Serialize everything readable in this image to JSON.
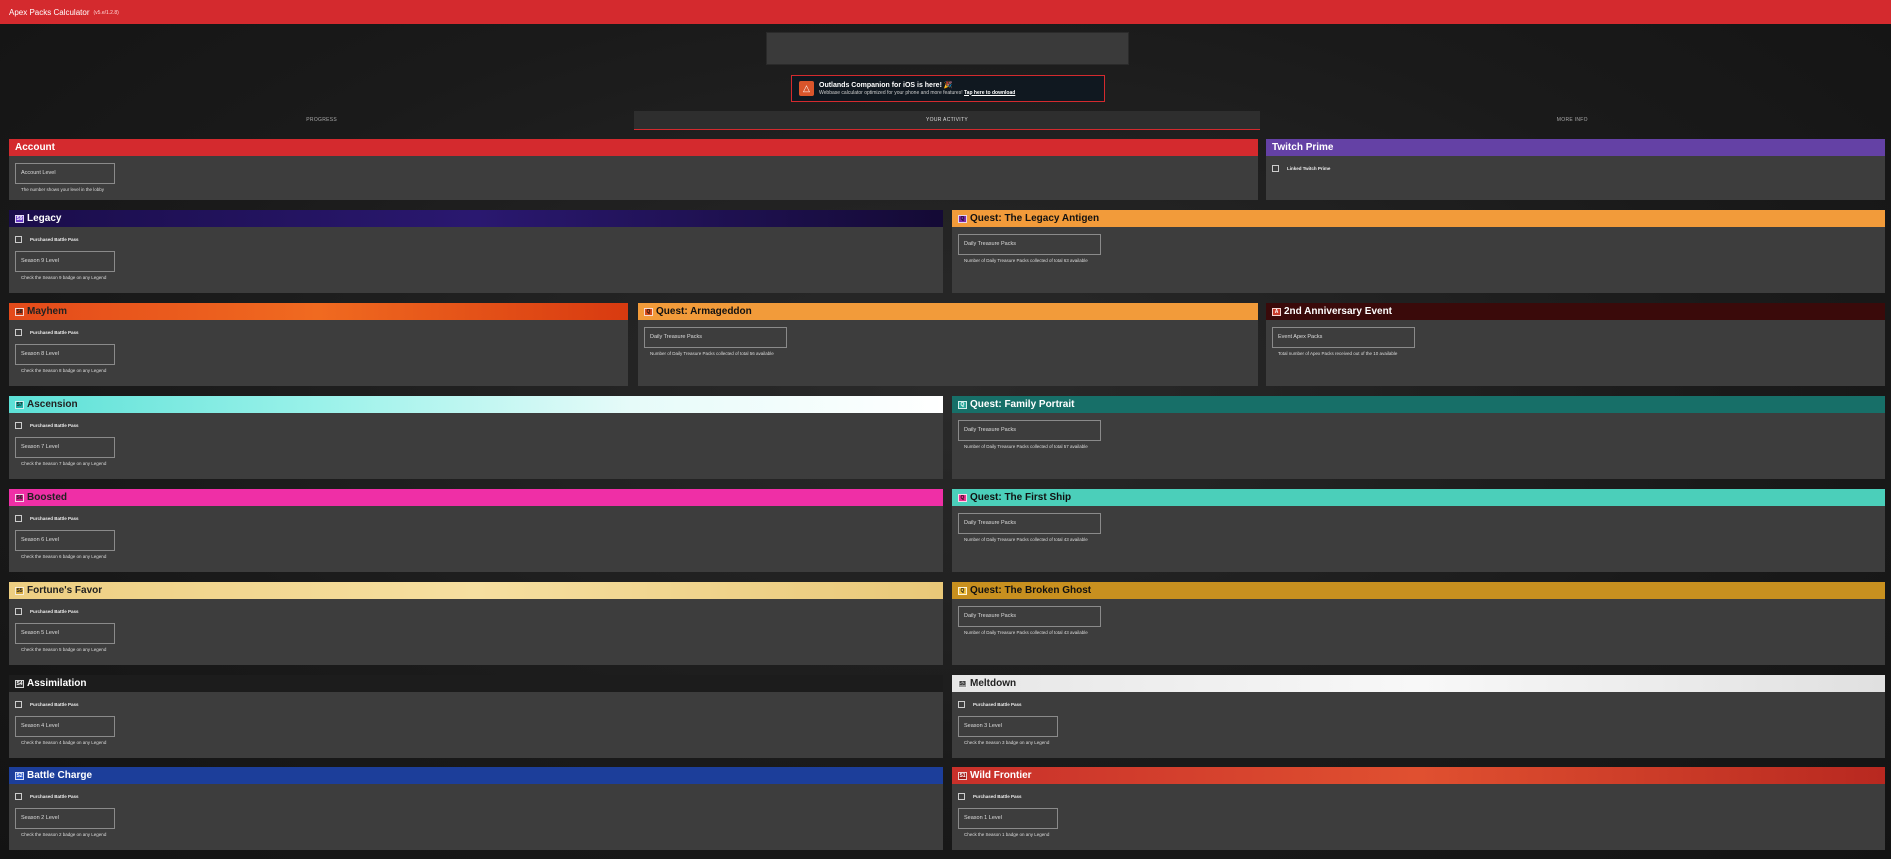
{
  "app": {
    "title": "Apex Packs Calculator",
    "version": "(v5.e/1.2.8)"
  },
  "promo": {
    "logo_icon": "apex-logo-icon",
    "headline": "Outlands Companion for iOS is here! 🎉",
    "sub": "Webbase calculator optimized for your phone and more features!",
    "link": "Tap here to download"
  },
  "tabs": [
    {
      "label": "PROGRESS"
    },
    {
      "label": "YOUR ACTIVITY"
    },
    {
      "label": "MORE INFO"
    }
  ],
  "account": {
    "title": "Account",
    "field": "Account Level",
    "hint": "The number shows your level in the lobby"
  },
  "twitch": {
    "title": "Twitch Prime",
    "checkbox": "Linked Twitch Prime"
  },
  "seasons": {
    "legacy": {
      "title": "Legacy",
      "checkbox": "Purchased Battle Pass",
      "field": "Season 9 Level",
      "hint": "Check the Season 9 badge on any Legend"
    },
    "mayhem": {
      "title": "Mayhem",
      "checkbox": "Purchased Battle Pass",
      "field": "Season 8 Level",
      "hint": "Check the Season 8 badge on any Legend"
    },
    "ascension": {
      "title": "Ascension",
      "checkbox": "Purchased Battle Pass",
      "field": "Season 7 Level",
      "hint": "Check the Season 7 badge on any Legend"
    },
    "boosted": {
      "title": "Boosted",
      "checkbox": "Purchased Battle Pass",
      "field": "Season 6 Level",
      "hint": "Check the Season 6 badge on any Legend"
    },
    "fortune": {
      "title": "Fortune's Favor",
      "checkbox": "Purchased Battle Pass",
      "field": "Season 5 Level",
      "hint": "Check the Season 5 badge on any Legend"
    },
    "assimilation": {
      "title": "Assimilation",
      "checkbox": "Purchased Battle Pass",
      "field": "Season 4 Level",
      "hint": "Check the Season 4 badge on any Legend"
    },
    "meltdown": {
      "title": "Meltdown",
      "checkbox": "Purchased Battle Pass",
      "field": "Season 3 Level",
      "hint": "Check the Season 3 badge on any Legend"
    },
    "battlecharge": {
      "title": "Battle Charge",
      "checkbox": "Purchased Battle Pass",
      "field": "Season 2 Level",
      "hint": "Check the Season 2 badge on any Legend"
    },
    "wildfrontier": {
      "title": "Wild Frontier",
      "checkbox": "Purchased Battle Pass",
      "field": "Season 1 Level",
      "hint": "Check the Season 1 badge on any Legend"
    }
  },
  "quests": {
    "antigen": {
      "title": "Quest: The Legacy Antigen",
      "field": "Daily Treasure Packs",
      "hint": "Number of Daily Treasure Packs collected of total 63 available"
    },
    "armageddon": {
      "title": "Quest: Armageddon",
      "field": "Daily Treasure Packs",
      "hint": "Number of Daily Treasure Packs collected of total 56 available"
    },
    "family": {
      "title": "Quest: Family Portrait",
      "field": "Daily Treasure Packs",
      "hint": "Number of Daily Treasure Packs collected of total 57 available"
    },
    "firstship": {
      "title": "Quest: The First Ship",
      "field": "Daily Treasure Packs",
      "hint": "Number of Daily Treasure Packs collected of total 43 available"
    },
    "brokenghost": {
      "title": "Quest: The Broken Ghost",
      "field": "Daily Treasure Packs",
      "hint": "Number of Daily Treasure Packs collected of total 43 available"
    }
  },
  "anniversary": {
    "title": "2nd Anniversary Event",
    "field": "Event Apex Packs",
    "hint": "Total number of Apex Packs received out of the 10 available"
  },
  "colors": {
    "brand": "#d42a2e",
    "twitch": "#6441a5",
    "quest_orange": "#f29b3a",
    "anniversary": "#3a0a0a",
    "family": "#176f68",
    "firstship": "#4bcfba",
    "brokenghost": "#c8901f",
    "boosted": "#ef2fa6",
    "battlecharge": "#1c3e9a"
  }
}
